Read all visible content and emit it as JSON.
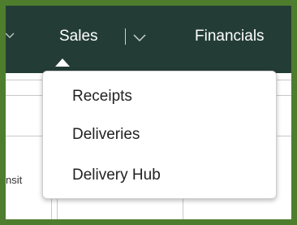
{
  "nav": {
    "items": [
      {
        "label": "Sales"
      },
      {
        "label": "Financials"
      }
    ]
  },
  "dropdown": {
    "items": [
      {
        "label": "Receipts"
      },
      {
        "label": "Deliveries"
      },
      {
        "label": "Delivery Hub"
      }
    ]
  },
  "background": {
    "partial_column_text": "nsit"
  },
  "colors": {
    "frame_border": "#4e7d2e",
    "navbar_bg": "#233d36",
    "nav_text": "#ffffff",
    "menu_text": "#222222"
  }
}
